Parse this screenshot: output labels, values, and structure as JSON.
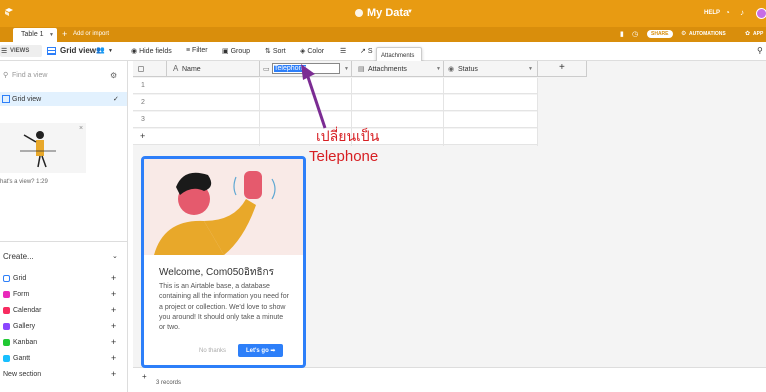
{
  "topbar": {
    "title": "My Data",
    "help": "HELP",
    "share": "SHARE",
    "automations": "AUTOMATIONS",
    "apps": "APP",
    "bg": "#e89b12"
  },
  "tabs": {
    "active": "Table 1",
    "add": "Add or import"
  },
  "toolbar": {
    "views": "VIEWS",
    "grid_view": "Grid view",
    "hide_fields": "Hide fields",
    "filter": "Filter",
    "group": "Group",
    "sort": "Sort",
    "color": "Color",
    "share_view": "S",
    "tooltip": "Attachments"
  },
  "sidebar": {
    "find_placeholder": "Find a view",
    "active_view": "Grid view",
    "video_caption": "hat's a view? 1:29",
    "create": "Create...",
    "items": [
      {
        "label": "Grid",
        "color": "#2d7ff9"
      },
      {
        "label": "Form",
        "color": "#e929ba"
      },
      {
        "label": "Calendar",
        "color": "#f82b60"
      },
      {
        "label": "Gallery",
        "color": "#8b46ff"
      },
      {
        "label": "Kanban",
        "color": "#20c933"
      },
      {
        "label": "Gantt",
        "color": "#18bfff"
      },
      {
        "label": "New section",
        "color": ""
      }
    ]
  },
  "grid": {
    "columns": [
      "Name",
      "Telephone",
      "Attachments",
      "Status"
    ],
    "rows": [
      "1",
      "2",
      "3"
    ],
    "footer": "3 records"
  },
  "annotation": {
    "line1": "เปลี่ยนเป็น",
    "line2": "Telephone"
  },
  "modal": {
    "title": "Welcome, Com050อิทธิกร",
    "body": "This is an Airtable base, a database containing all the information you need for a project or collection. We'd love to show you around! It should only take a minute or two.",
    "no_thanks": "No thanks",
    "lets_go": "Let's go ➡"
  }
}
